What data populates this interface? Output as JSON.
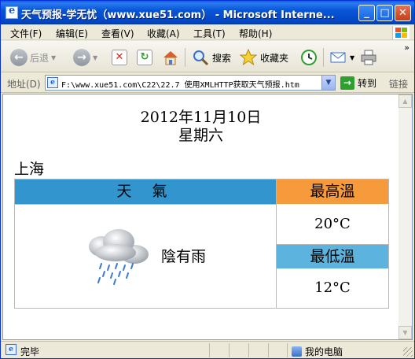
{
  "window": {
    "title": "天气预报-学无忧（www.xue51.com） - Microsoft Interne...",
    "buttons": {
      "minimize": "_",
      "maximize": "□",
      "close": "✕"
    }
  },
  "menu": {
    "items": [
      "文件(F)",
      "编辑(E)",
      "查看(V)",
      "收藏(A)",
      "工具(T)",
      "帮助(H)"
    ]
  },
  "toolbar": {
    "back_label": "后退",
    "search_label": "搜索",
    "favorites_label": "收藏夹",
    "more": "»"
  },
  "address": {
    "label": "地址(D)",
    "value": "F:\\www.xue51.com\\C22\\22.7  使用XMLHTTP获取天气预报.htm",
    "go_label": "转到",
    "links_label": "链接"
  },
  "page": {
    "date": "2012年11月10日",
    "weekday": "星期六",
    "city": "上海",
    "table": {
      "weather_header": "天 氣",
      "high_header": "最高溫",
      "high_value": "20°C",
      "low_header": "最低溫",
      "low_value": "12°C",
      "condition": "陰有雨",
      "condition_icon": "cloud-rain-icon"
    }
  },
  "status": {
    "text": "完毕",
    "zone": "我的电脑"
  },
  "colors": {
    "weather_header_bg": "#3295ce",
    "high_header_bg": "#f79a3c",
    "low_header_bg": "#5cb4de",
    "titlebar": "#0756d6"
  }
}
